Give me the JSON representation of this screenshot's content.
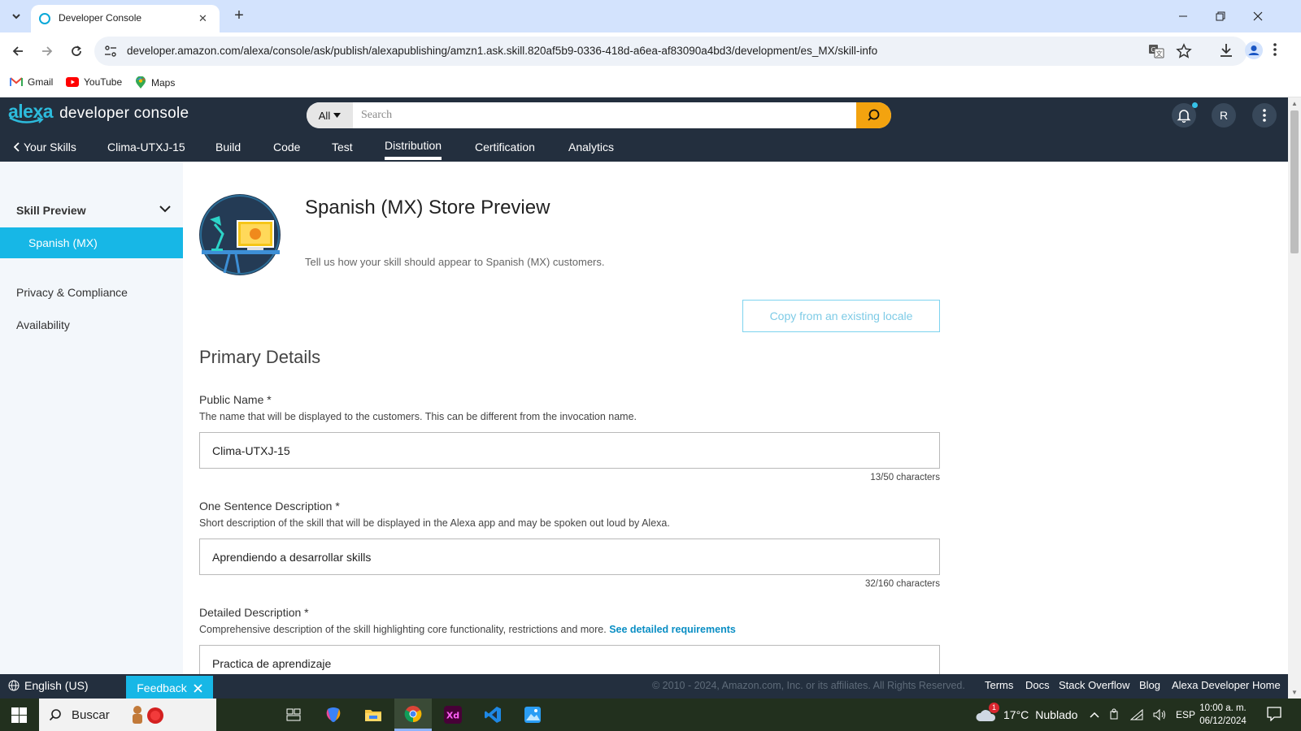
{
  "browser": {
    "tab_title": "Developer Console",
    "url": "developer.amazon.com/alexa/console/ask/publish/alexapublishing/amzn1.ask.skill.820af5b9-0336-418d-a6ea-af83090a4bd3/development/es_MX/skill-info",
    "bookmarks": [
      {
        "label": "Gmail",
        "icon": "gmail-icon"
      },
      {
        "label": "YouTube",
        "icon": "youtube-icon"
      },
      {
        "label": "Maps",
        "icon": "maps-icon"
      }
    ]
  },
  "header": {
    "logo_alexa": "alexa",
    "logo_text": "developer console",
    "search_scope": "All",
    "search_placeholder": "Search",
    "avatar_initial": "R",
    "nav": {
      "back": "Your Skills",
      "skill": "Clima-UTXJ-15",
      "build": "Build",
      "code": "Code",
      "test": "Test",
      "distribution": "Distribution",
      "certification": "Certification",
      "analytics": "Analytics"
    }
  },
  "sidebar": {
    "heading": "Skill Preview",
    "active_item": "Spanish (MX)",
    "privacy": "Privacy & Compliance",
    "availability": "Availability"
  },
  "main": {
    "title": "Spanish (MX) Store Preview",
    "subtitle": "Tell us how your skill should appear to Spanish (MX) customers.",
    "copy_button": "Copy from an existing locale",
    "section_title": "Primary Details",
    "public_name": {
      "label": "Public Name *",
      "help": "The name that will be displayed to the customers. This can be different from the invocation name.",
      "value": "Clima-UTXJ-15",
      "count": "13/50 characters"
    },
    "one_sentence": {
      "label": "One Sentence Description *",
      "help": "Short description of the skill that will be displayed in the Alexa app and may be spoken out loud by Alexa.",
      "value": "Aprendiendo a desarrollar skills",
      "count": "32/160 characters"
    },
    "detailed": {
      "label": "Detailed Description *",
      "help": "Comprehensive description of the skill highlighting core functionality, restrictions and more.",
      "link": "See detailed requirements",
      "value": "Practica de aprendizaje"
    }
  },
  "footer": {
    "language": "English (US)",
    "feedback": "Feedback",
    "copyright": "© 2010 - 2024, Amazon.com, Inc. or its affiliates. All Rights Reserved.",
    "links": {
      "terms": "Terms",
      "docs": "Docs",
      "stack_overflow": "Stack Overflow",
      "blog": "Blog",
      "home": "Alexa Developer Home"
    }
  },
  "taskbar": {
    "search": "Buscar",
    "weather_temp": "17°C",
    "weather_desc": "Nublado",
    "weather_badge": "1",
    "lang": "ESP",
    "time": "10:00 a. m.",
    "date": "06/12/2024"
  },
  "colors": {
    "header_bg": "#232f3e",
    "accent": "#17b7e6",
    "search_button": "#f3a30f",
    "tabbar": "#d3e3fd"
  }
}
